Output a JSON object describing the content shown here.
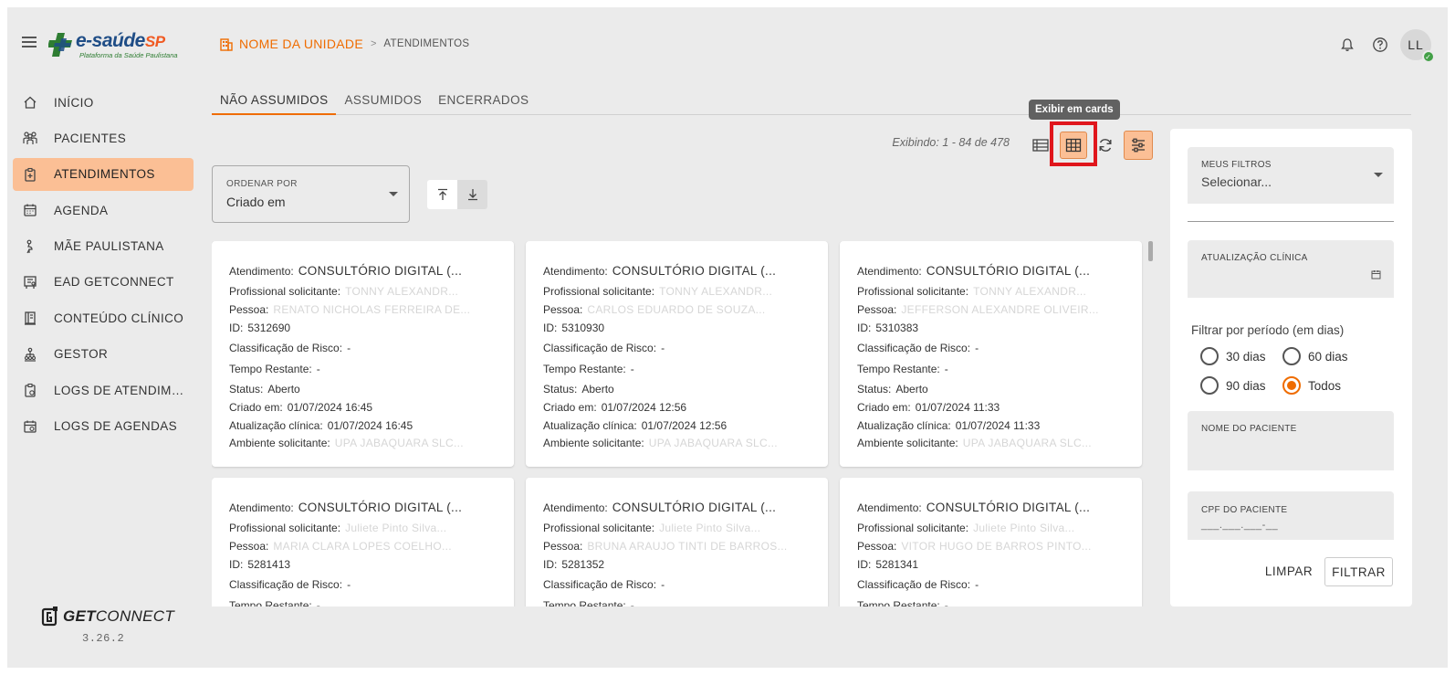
{
  "header": {
    "logo_title": "e-saúde",
    "logo_title_suffix": "SP",
    "logo_subtitle": "Plataforma da Saúde Paulistana",
    "unit_name": "NOME DA UNIDADE",
    "separator": ">",
    "current_page": "ATENDIMENTOS",
    "avatar_initials": "LL"
  },
  "sidebar": {
    "items": [
      {
        "label": "INÍCIO",
        "icon": "home-icon"
      },
      {
        "label": "PACIENTES",
        "icon": "patients-icon"
      },
      {
        "label": "ATENDIMENTOS",
        "icon": "clipboard-icon"
      },
      {
        "label": "AGENDA",
        "icon": "calendar-icon"
      },
      {
        "label": "MÃE PAULISTANA",
        "icon": "mother-icon"
      },
      {
        "label": "EAD GETCONNECT",
        "icon": "course-icon"
      },
      {
        "label": "CONTEÚDO CLÍNICO",
        "icon": "book-icon"
      },
      {
        "label": "GESTOR",
        "icon": "org-icon"
      },
      {
        "label": "LOGS DE ATENDIME...",
        "icon": "log-clipboard-icon"
      },
      {
        "label": "LOGS DE AGENDAS",
        "icon": "log-calendar-icon"
      }
    ],
    "brand_bold": "GET",
    "brand_rest": "CONNECT",
    "version": "3.26.2"
  },
  "tabs": [
    "NÃO ASSUMIDOS",
    "ASSUMIDOS",
    "ENCERRADOS"
  ],
  "toolbar": {
    "showing": "Exibindo: 1 - 84 de 478",
    "tooltip": "Exibir em cards"
  },
  "order": {
    "label": "ORDENAR POR",
    "value": "Criado em"
  },
  "labels": {
    "atendimento": "Atendimento:",
    "profissional": "Profissional solicitante:",
    "pessoa": "Pessoa:",
    "id": "ID:",
    "risco": "Classificação de Risco:",
    "tempo": "Tempo Restante:",
    "status": "Status:",
    "criado": "Criado em:",
    "atualizacao": "Atualização clínica:",
    "ambiente": "Ambiente solicitante:"
  },
  "cards": [
    {
      "atendimento": "CONSULTÓRIO DIGITAL (...",
      "profissional": "TONNY ALEXANDR...",
      "pessoa": "RENATO NICHOLAS FERREIRA DE...",
      "id": "5312690",
      "risco": "-",
      "tempo": "-",
      "status": "Aberto",
      "criado": "01/07/2024 16:45",
      "atualizacao": "01/07/2024 16:45",
      "ambiente": "UPA JABAQUARA SLC..."
    },
    {
      "atendimento": "CONSULTÓRIO DIGITAL (...",
      "profissional": "TONNY ALEXANDR...",
      "pessoa": "CARLOS EDUARDO DE SOUZA...",
      "id": "5310930",
      "risco": "-",
      "tempo": "-",
      "status": "Aberto",
      "criado": "01/07/2024 12:56",
      "atualizacao": "01/07/2024 12:56",
      "ambiente": "UPA JABAQUARA SLC..."
    },
    {
      "atendimento": "CONSULTÓRIO DIGITAL (...",
      "profissional": "TONNY ALEXANDR...",
      "pessoa": "JEFFERSON ALEXANDRE OLIVEIR...",
      "id": "5310383",
      "risco": "-",
      "tempo": "-",
      "status": "Aberto",
      "criado": "01/07/2024 11:33",
      "atualizacao": "01/07/2024 11:33",
      "ambiente": "UPA JABAQUARA SLC..."
    },
    {
      "atendimento": "CONSULTÓRIO DIGITAL (...",
      "profissional": "Juliete Pinto Silva...",
      "pessoa": "MARIA CLARA LOPES COELHO...",
      "id": "5281413",
      "risco": "-",
      "tempo": "-"
    },
    {
      "atendimento": "CONSULTÓRIO DIGITAL (...",
      "profissional": "Juliete Pinto Silva...",
      "pessoa": "BRUNA ARAUJO TINTI DE BARROS...",
      "id": "5281352",
      "risco": "-",
      "tempo": "-"
    },
    {
      "atendimento": "CONSULTÓRIO DIGITAL (...",
      "profissional": "Juliete Pinto Silva...",
      "pessoa": "VITOR HUGO DE BARROS PINTO...",
      "id": "5281341",
      "risco": "-",
      "tempo": "-"
    }
  ],
  "filters": {
    "my_filters_label": "MEUS FILTROS",
    "my_filters_value": "Selecionar...",
    "clinical_update_label": "ATUALIZAÇÃO CLÍNICA",
    "period_label": "Filtrar por período (em dias)",
    "periods": [
      {
        "label": "30 dias",
        "selected": false
      },
      {
        "label": "60 dias",
        "selected": false
      },
      {
        "label": "90 dias",
        "selected": false
      },
      {
        "label": "Todos",
        "selected": true
      }
    ],
    "patient_name_label": "NOME DO PACIENTE",
    "patient_cpf_label": "CPF DO PACIENTE",
    "patient_cpf_placeholder": "___.___.___-__",
    "clear_label": "LIMPAR",
    "filter_label": "FILTRAR"
  },
  "colors": {
    "accent": "#ef6c00",
    "active_bg": "#fbbf95",
    "highlight": "#e0161c",
    "brand_blue": "#1f4d86",
    "brand_green": "#2e7d32"
  }
}
